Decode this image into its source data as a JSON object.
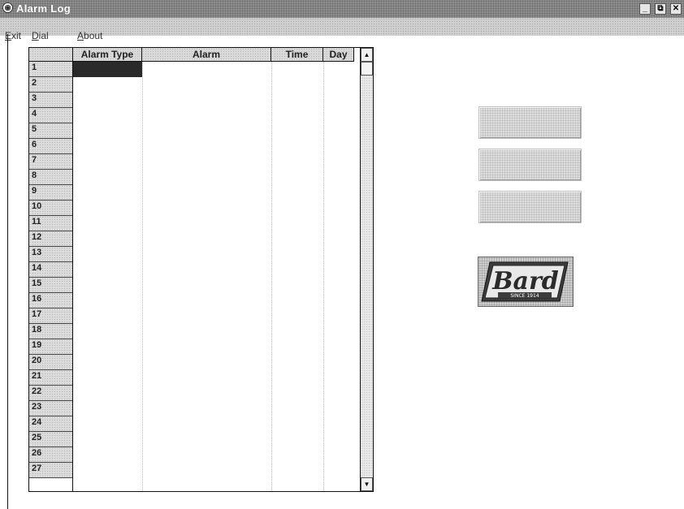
{
  "window": {
    "title": "Alarm Log",
    "icon": "app-icon",
    "controls": {
      "minimize": "_",
      "restore": "⧉",
      "close": "✕"
    }
  },
  "menu": {
    "items": [
      {
        "label": "Exit",
        "shortcut": "x"
      },
      {
        "label": "Dial",
        "shortcut": "D"
      },
      {
        "label": "About",
        "shortcut": "A"
      }
    ]
  },
  "grid": {
    "columns": [
      "Alarm Type",
      "Alarm",
      "Time",
      "Day"
    ],
    "row_numbers": [
      "1",
      "2",
      "3",
      "4",
      "5",
      "6",
      "7",
      "8",
      "9",
      "10",
      "11",
      "12",
      "13",
      "14",
      "15",
      "16",
      "17",
      "18",
      "19",
      "20",
      "21",
      "22",
      "23",
      "24",
      "25",
      "26",
      "27"
    ],
    "selected_cell": {
      "row": "1",
      "column": "Alarm Type"
    },
    "scroll_up": "▲",
    "scroll_down": "▼"
  },
  "buttons": [
    {
      "label": "",
      "state": "disabled"
    },
    {
      "label": "",
      "state": "disabled"
    },
    {
      "label": "",
      "state": "disabled"
    }
  ],
  "logo": {
    "word": "Bard",
    "tagline": "SINCE 1914"
  },
  "colors": {
    "titlebar": "#8e8e8e",
    "selection": "#2a2a2a",
    "logo_fill": "#3d3d3d"
  }
}
